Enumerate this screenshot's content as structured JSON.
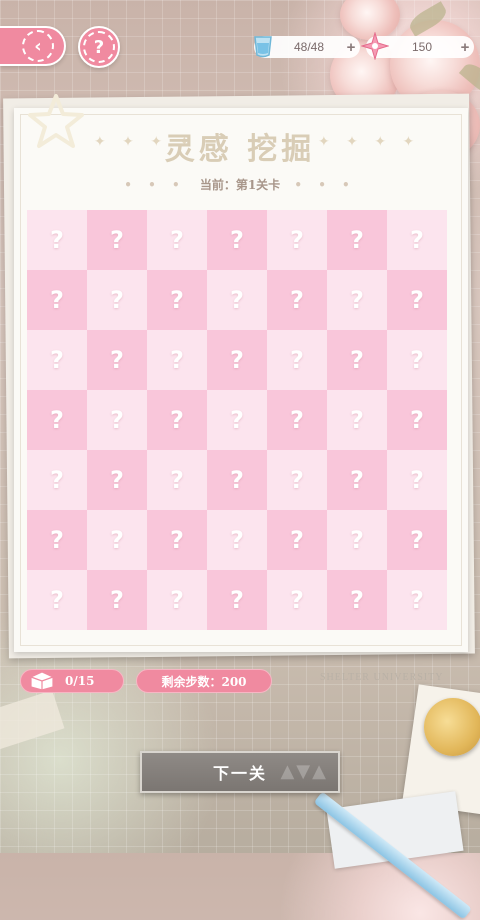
{
  "header": {
    "back_icon": "chevron-left-icon",
    "help_label": "?",
    "water": {
      "icon": "water-cup-icon",
      "value": "48/48",
      "plus": "+"
    },
    "crystal": {
      "icon": "pink-star-crystal-icon",
      "value": "150",
      "plus": "+"
    }
  },
  "panel": {
    "title": "灵感 挖掘",
    "subtitle": "当前：第1关卡",
    "sparkles": "✦ ✦ ✦ ✦",
    "dots": "• • •"
  },
  "board": {
    "rows": 7,
    "cols": 7,
    "cell_label": "?",
    "light_color": "#fce4ee",
    "dark_color": "#f9c6da"
  },
  "footer": {
    "found_count": "0/15",
    "found_icon": "cake-box-icon",
    "steps_label": "剩余步数：200",
    "stamp_text": "SHELTER UNIVERSITY",
    "next_button": "下一关"
  },
  "colors": {
    "accent_pink": "#f08aa0",
    "button_gray": "#8f8a86"
  }
}
